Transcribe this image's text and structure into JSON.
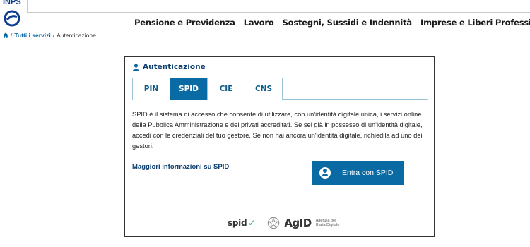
{
  "header": {
    "logo_text": "INPS",
    "nav": [
      {
        "label": "Pensione e Previdenza"
      },
      {
        "label": "Lavoro"
      },
      {
        "label": "Sostegni, Sussidi e Indennità"
      },
      {
        "label": "Imprese e Liberi Professionisti"
      }
    ]
  },
  "breadcrumb": {
    "home_icon": "home-icon",
    "separator": "/",
    "link": "Tutti i servizi",
    "current": "Autenticazione"
  },
  "auth": {
    "title": "Autenticazione",
    "title_icon": "user-icon",
    "tabs": [
      {
        "label": "PIN",
        "active": false
      },
      {
        "label": "SPID",
        "active": true
      },
      {
        "label": "CIE",
        "active": false
      },
      {
        "label": "CNS",
        "active": false
      }
    ],
    "description": "SPID è il sistema di accesso che consente di utilizzare, con un'identità digitale unica, i servizi online della Pubblica Amministrazione e dei privati accreditati. Se sei già in possesso di un'identità digitale, accedi con le credenziali del tuo gestore. Se non hai ancora un'identità digitale, richiedila ad uno dei gestori.",
    "more_info_link": "Maggiori informazioni su SPID",
    "spid_button": {
      "label": "Entra con SPID",
      "icon": "user-circle-icon"
    },
    "footer": {
      "spid_logo_text": "spid",
      "agid_logo_text": "AgID",
      "agid_subtitle": "Agenzia per l'Italia Digitale"
    }
  },
  "colors": {
    "primary_blue": "#0a6aa3",
    "dark_blue": "#0b3d6e",
    "tab_border": "#9ac4d9",
    "spid_check_green": "#2aa14a"
  }
}
